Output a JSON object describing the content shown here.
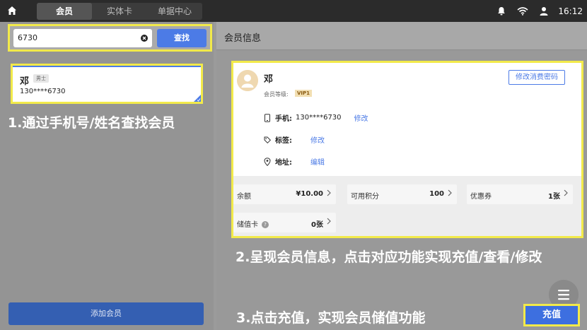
{
  "topbar": {
    "tabs": [
      {
        "label": "会员",
        "active": true
      },
      {
        "label": "实体卡",
        "active": false
      },
      {
        "label": "单据中心",
        "active": false
      }
    ],
    "time": "16:12",
    "icons": [
      "home-icon",
      "bell-icon",
      "wifi-icon",
      "user-icon"
    ]
  },
  "search": {
    "value": "6730",
    "button_label": "查找"
  },
  "member_card": {
    "name": "邓",
    "gender": "男士",
    "phone": "130****6730"
  },
  "left_caption": "1.通过手机号/姓名查找会员",
  "add_member_label": "添加会员",
  "member_info": {
    "header_title": "会员信息",
    "name": "邓",
    "change_password_label": "修改消费密码",
    "level_label": "会员等级:",
    "level_value": "VIP1",
    "phone_label": "手机:",
    "phone_value": "130****6730",
    "phone_action": "修改",
    "tag_label": "标签:",
    "tag_action": "修改",
    "address_label": "地址:",
    "address_action": "编辑",
    "stats": {
      "balance_label": "余额",
      "balance_value": "¥10.00",
      "points_label": "可用积分",
      "points_value": "100",
      "coupon_label": "优惠券",
      "coupon_value": "1张",
      "stored_card_label": "储值卡",
      "stored_card_value": "0张"
    }
  },
  "right_caption_1": "2.呈现会员信息，点击对应功能实现充值/查看/修改",
  "right_caption_2": "3.点击充值，实现会员储值功能",
  "recharge_label": "充值",
  "colors": {
    "accent": "#4c7be6",
    "highlight": "#f2ea4a",
    "topbar": "#2b2b2b"
  }
}
